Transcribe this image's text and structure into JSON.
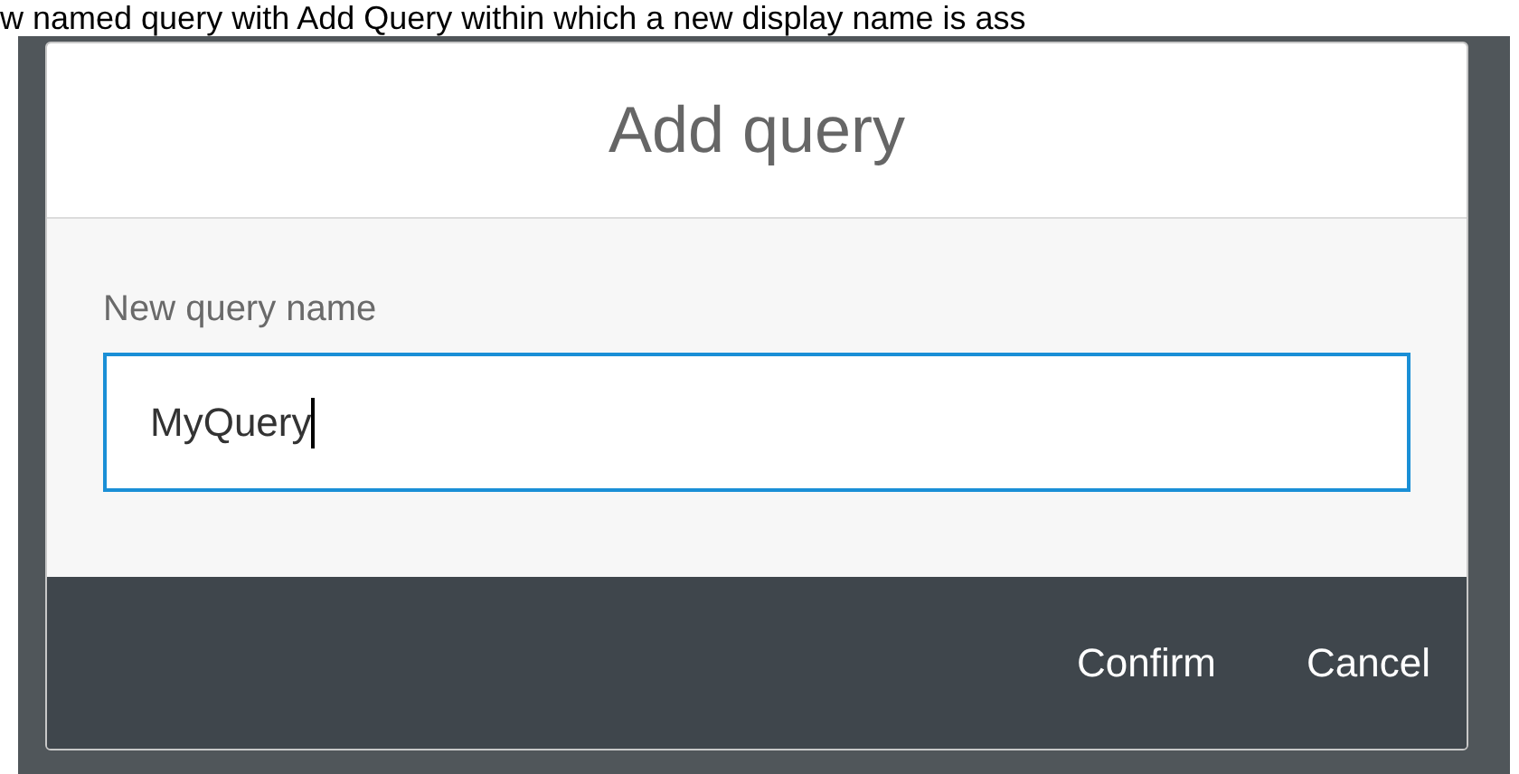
{
  "caption": "w named query with Add Query within which a new display name is ass",
  "dialog": {
    "title": "Add query",
    "field": {
      "label": "New query name",
      "value": "MyQuery"
    },
    "buttons": [
      "Confirm",
      "Cancel"
    ]
  }
}
